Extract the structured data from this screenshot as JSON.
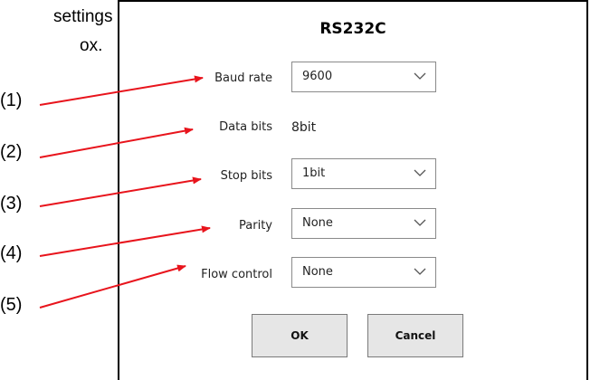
{
  "annotations": {
    "partial_text_line1": "settings",
    "partial_text_line2": "ox.",
    "callouts": [
      "(1)",
      "(2)",
      "(3)",
      "(4)",
      "(5)"
    ]
  },
  "dialog": {
    "title": "RS232C",
    "baud_rate": {
      "label": "Baud rate",
      "value": "9600"
    },
    "data_bits": {
      "label": "Data bits",
      "value": "8bit"
    },
    "stop_bits": {
      "label": "Stop bits",
      "value": "1bit"
    },
    "parity": {
      "label": "Parity",
      "value": "None"
    },
    "flow_control": {
      "label": "Flow control",
      "value": "None"
    },
    "ok_label": "OK",
    "cancel_label": "Cancel"
  },
  "colors": {
    "arrow": "#e8141c",
    "border": "#000000",
    "button_bg": "#e6e6e6"
  }
}
